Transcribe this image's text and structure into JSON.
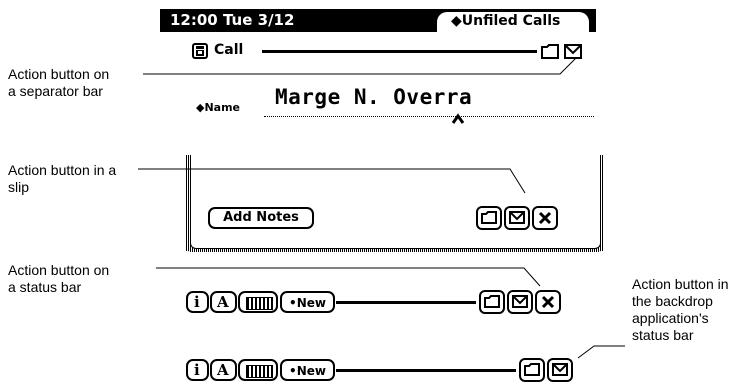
{
  "header": {
    "time_date": "12:00 Tue 3/12",
    "folder_tab": "◆Unfiled Calls"
  },
  "separator": {
    "label": "Call"
  },
  "name_field": {
    "label": "◆Name",
    "value": "Marge N. Overra"
  },
  "slip": {
    "add_notes_label": "Add Notes"
  },
  "status_bar_1": {
    "new_label": "•New"
  },
  "status_bar_2": {
    "new_label": "•New"
  },
  "callouts": {
    "separator_bar": [
      "Action button on",
      "a separator bar"
    ],
    "slip": [
      "Action button in a",
      "slip"
    ],
    "status_bar": [
      "Action button on",
      "a status bar"
    ],
    "backdrop": [
      "Action button in",
      "the backdrop",
      "application's",
      "status bar"
    ]
  },
  "icons": {
    "phone": "phone-icon",
    "folder": "folder-icon",
    "envelope": "envelope-icon",
    "close": "close-icon",
    "info": "info-icon",
    "font": "font-icon",
    "keyboard": "keyboard-icon"
  }
}
